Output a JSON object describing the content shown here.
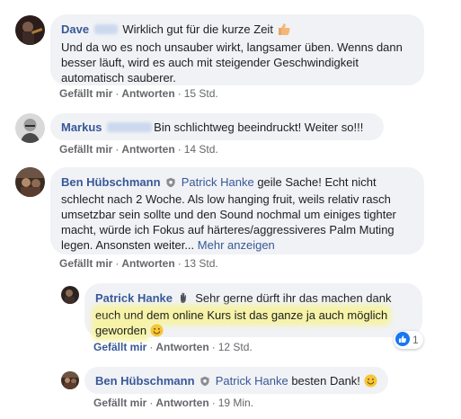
{
  "comments": [
    {
      "author": "Dave",
      "text_lines": [
        "Wirklich gut für die kurze Zeit",
        "Und da wo es noch unsauber wirkt, langsamer üben. Wenns dann",
        "besser läuft, wird es auch mit steigender Geschwindigkeit",
        "automatisch sauberer."
      ],
      "emoji": "thumbs-up-icon",
      "like": "Gefällt mir",
      "reply": "Antworten",
      "time": "15 Std."
    },
    {
      "author": "Markus",
      "text": "Bin schlichtweg beeindruckt! Weiter so!!!",
      "like": "Gefällt mir",
      "reply": "Antworten",
      "time": "14 Std."
    },
    {
      "author": "Ben Hübschmann",
      "tag": "Patrick Hanke",
      "text_lines": [
        "geile Sache! Echt nicht",
        "schlecht nach 2 Woche. Als low hanging fruit, weils relativ rasch",
        "umsetzbar sein sollte und den Sound nochmal um einiges tighter",
        "macht, würde ich Fokus auf härteres/aggressiveres Palm Muting",
        "legen. Ansonsten weiter..."
      ],
      "more": "Mehr anzeigen",
      "like": "Gefällt mir",
      "reply": "Antworten",
      "time": "13 Std."
    }
  ],
  "replies": [
    {
      "author": "Patrick Hanke",
      "text_lines": [
        "Sehr gerne dürft ihr das machen dank",
        "euch und dem online Kurs ist das ganze ja auch möglich",
        "geworden"
      ],
      "emoji": "smiley-icon",
      "like": "Gefällt mir",
      "reply": "Antworten",
      "time": "12 Std.",
      "reaction_count": "1",
      "liked": true
    },
    {
      "author": "Ben Hübschmann",
      "tag": "Patrick Hanke",
      "text": "besten Dank!",
      "emoji": "smiley-icon",
      "like": "Gefällt mir",
      "reply": "Antworten",
      "time": "19 Min."
    }
  ],
  "separator": "·",
  "colors": {
    "link": "#385898",
    "bubble": "#f0f2f5",
    "meta": "#65676b",
    "highlight": "#f6f3a8",
    "like_blue": "#1877f2"
  }
}
